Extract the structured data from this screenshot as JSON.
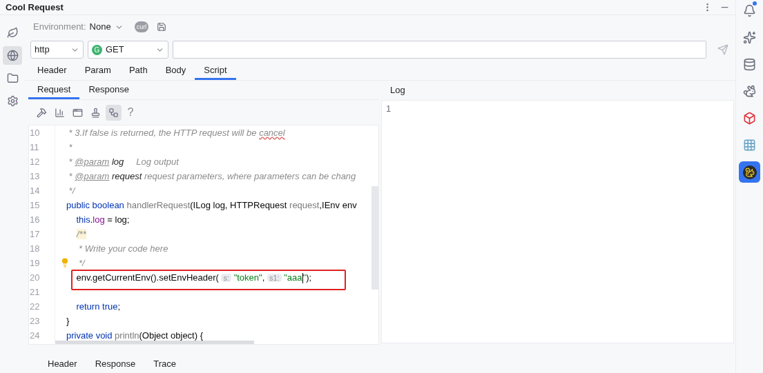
{
  "window": {
    "title": "Cool Request"
  },
  "left_toolbar": [
    {
      "kind": "leaf",
      "selected": false
    },
    {
      "kind": "request",
      "selected": true
    },
    {
      "kind": "folder",
      "selected": false
    },
    {
      "kind": "settings",
      "selected": false
    }
  ],
  "environment": {
    "label": "Environment:",
    "value": "None",
    "curl_badge": "curl"
  },
  "protocol_select": {
    "value": "http"
  },
  "method_select": {
    "badge": "G",
    "value": "GET"
  },
  "request_tabs": [
    {
      "label": "Header",
      "selected": false
    },
    {
      "label": "Param",
      "selected": false
    },
    {
      "label": "Path",
      "selected": false
    },
    {
      "label": "Body",
      "selected": false
    },
    {
      "label": "Script",
      "selected": true
    }
  ],
  "script_tabs": [
    {
      "label": "Request",
      "selected": true
    },
    {
      "label": "Response",
      "selected": false
    }
  ],
  "editor_toolbar": {
    "tools": [
      {
        "kind": "hammer",
        "selected": false
      },
      {
        "kind": "columns",
        "selected": false
      },
      {
        "kind": "window",
        "selected": false
      },
      {
        "kind": "stamp",
        "selected": false
      },
      {
        "kind": "nodes",
        "selected": true
      }
    ],
    "help": "?"
  },
  "editor": {
    "lines": [
      {
        "number": "10",
        "tokens": [
          {
            "kind": "comment",
            "text": " * 3.If false is returned, the HTTP request will be "
          },
          {
            "kind": "typo",
            "text": "cancel"
          }
        ]
      },
      {
        "number": "11",
        "tokens": [
          {
            "kind": "comment",
            "text": " *"
          }
        ]
      },
      {
        "number": "12",
        "tokens": [
          {
            "kind": "comment",
            "text": " * "
          },
          {
            "kind": "doctag",
            "text": "@param"
          },
          {
            "kind": "docparam",
            "text": " log"
          },
          {
            "kind": "comment",
            "text": "     Log output"
          }
        ]
      },
      {
        "number": "13",
        "tokens": [
          {
            "kind": "comment",
            "text": " * "
          },
          {
            "kind": "doctag",
            "text": "@param"
          },
          {
            "kind": "docparam",
            "text": " request"
          },
          {
            "kind": "comment",
            "text": " request parameters, where parameters can be chang"
          }
        ]
      },
      {
        "number": "14",
        "tokens": [
          {
            "kind": "comment",
            "text": " */"
          }
        ]
      },
      {
        "number": "15",
        "tokens": [
          {
            "kind": "keyword",
            "text": "public boolean "
          },
          {
            "kind": "unused",
            "text": "handlerRequest"
          },
          {
            "kind": "plain",
            "text": "(ILog log, HTTPRequest "
          },
          {
            "kind": "unused",
            "text": "request"
          },
          {
            "kind": "plain",
            "text": ",IEnv env"
          }
        ]
      },
      {
        "number": "16",
        "tokens": [
          {
            "kind": "keyword",
            "text": "    this"
          },
          {
            "kind": "plain",
            "text": "."
          },
          {
            "kind": "field",
            "text": "log"
          },
          {
            "kind": "plain",
            "text": " = log;"
          }
        ]
      },
      {
        "number": "17",
        "tokens": [
          {
            "kind": "indent"
          },
          {
            "kind": "match",
            "text": "/**"
          }
        ]
      },
      {
        "number": "18",
        "tokens": [
          {
            "kind": "comment",
            "text": "     * Write your code here"
          }
        ]
      },
      {
        "number": "19",
        "bulb": true,
        "tokens": [
          {
            "kind": "comment",
            "text": "     */"
          }
        ]
      },
      {
        "number": "20",
        "highlighted": true,
        "tokens": [
          {
            "kind": "plain",
            "text": "    env.getCurrentEnv().setEnvHeader( "
          },
          {
            "kind": "hint",
            "text": "s:"
          },
          {
            "kind": "string",
            "text": " \"token\""
          },
          {
            "kind": "plain",
            "text": ", "
          },
          {
            "kind": "hint",
            "text": "s1:"
          },
          {
            "kind": "string",
            "text": " \"aaa"
          },
          {
            "kind": "caret"
          },
          {
            "kind": "string",
            "text": "\""
          },
          {
            "kind": "plain",
            "text": ");"
          }
        ]
      },
      {
        "number": "21"
      },
      {
        "number": "22",
        "tokens": [
          {
            "kind": "keyword",
            "text": "    return true"
          },
          {
            "kind": "plain",
            "text": ";"
          }
        ]
      },
      {
        "number": "23",
        "tokens": [
          {
            "kind": "plain",
            "text": "}"
          }
        ]
      },
      {
        "number": "24",
        "tokens": [
          {
            "kind": "keyword",
            "text": "private void "
          },
          {
            "kind": "unused",
            "text": "println"
          },
          {
            "kind": "plain",
            "text": "(Object object) {"
          }
        ]
      }
    ]
  },
  "log_panel": {
    "tab": "Log",
    "lines": [
      {
        "number": "1"
      }
    ]
  },
  "bottom_tabs": [
    {
      "label": "Header",
      "selected": false
    },
    {
      "label": "Response",
      "selected": false
    },
    {
      "label": "Trace",
      "selected": false
    }
  ],
  "right_toolbar": [
    {
      "kind": "bell",
      "selected": false,
      "badge": true
    },
    {
      "kind": "sparkle",
      "selected": false
    },
    {
      "kind": "database",
      "selected": false
    },
    {
      "kind": "animal",
      "selected": false
    },
    {
      "kind": "cube",
      "selected": false
    },
    {
      "kind": "grid",
      "selected": false
    },
    {
      "kind": "squirrel",
      "selected": true
    }
  ]
}
